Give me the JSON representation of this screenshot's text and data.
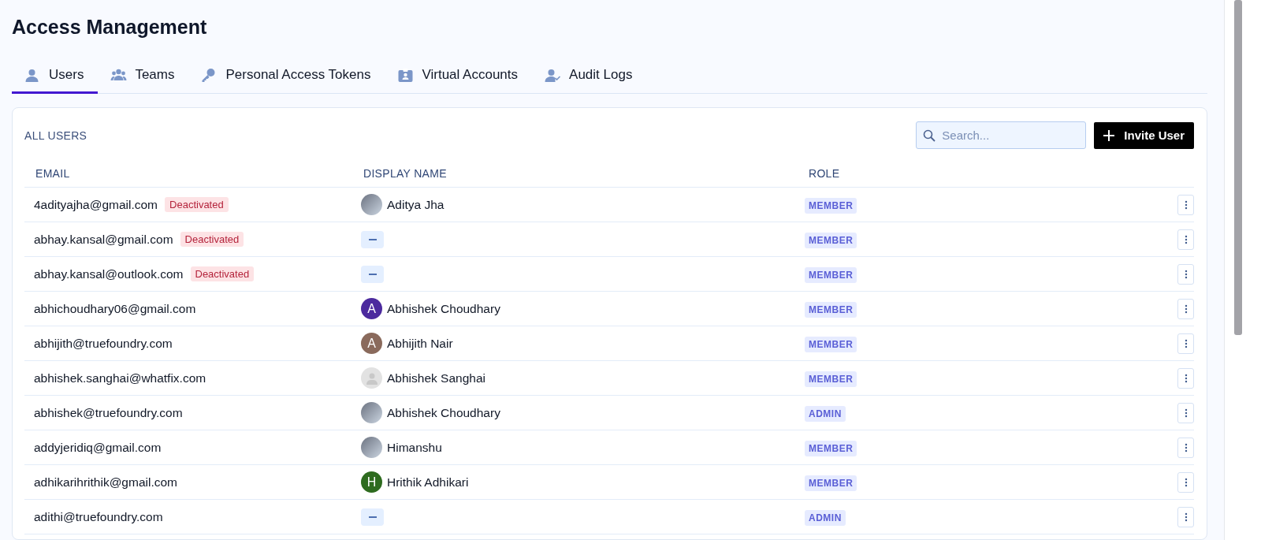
{
  "page_title": "Access Management",
  "tabs": [
    {
      "label": "Users",
      "selected": true
    },
    {
      "label": "Teams",
      "selected": false
    },
    {
      "label": "Personal Access Tokens",
      "selected": false
    },
    {
      "label": "Virtual Accounts",
      "selected": false
    },
    {
      "label": "Audit Logs",
      "selected": false
    }
  ],
  "users_card": {
    "title": "ALL USERS",
    "search": {
      "placeholder": "Search..."
    },
    "invite_button": "Invite User",
    "columns": [
      "EMAIL",
      "DISPLAY NAME",
      "ROLE"
    ],
    "rows": [
      {
        "email": "4adityajha@gmail.com",
        "status": "Deactivated",
        "avatar": {
          "kind": "photo"
        },
        "display_name": "Aditya Jha",
        "role": "MEMBER"
      },
      {
        "email": "abhay.kansal@gmail.com",
        "status": "Deactivated",
        "avatar": {
          "kind": "none"
        },
        "role": "MEMBER"
      },
      {
        "email": "abhay.kansal@outlook.com",
        "status": "Deactivated",
        "avatar": {
          "kind": "none"
        },
        "role": "MEMBER"
      },
      {
        "email": "abhichoudhary06@gmail.com",
        "avatar": {
          "kind": "initial",
          "letter": "A",
          "color": "#4c2a9e"
        },
        "display_name": "Abhishek Choudhary",
        "role": "MEMBER"
      },
      {
        "email": "abhijith@truefoundry.com",
        "avatar": {
          "kind": "initial",
          "letter": "A",
          "color": "#8a6a5c"
        },
        "display_name": "Abhijith Nair",
        "role": "MEMBER"
      },
      {
        "email": "abhishek.sanghai@whatfix.com",
        "avatar": {
          "kind": "placeholder"
        },
        "display_name": "Abhishek Sanghai",
        "role": "MEMBER"
      },
      {
        "email": "abhishek@truefoundry.com",
        "avatar": {
          "kind": "photo"
        },
        "display_name": "Abhishek Choudhary",
        "role": "ADMIN"
      },
      {
        "email": "addyjeridiq@gmail.com",
        "avatar": {
          "kind": "photo"
        },
        "display_name": "Himanshu",
        "role": "MEMBER"
      },
      {
        "email": "adhikarihrithik@gmail.com",
        "avatar": {
          "kind": "initial",
          "letter": "H",
          "color": "#2e6b1f"
        },
        "display_name": "Hrithik Adhikari",
        "role": "MEMBER"
      },
      {
        "email": "adithi@truefoundry.com",
        "avatar": {
          "kind": "none"
        },
        "role": "ADMIN"
      }
    ]
  }
}
